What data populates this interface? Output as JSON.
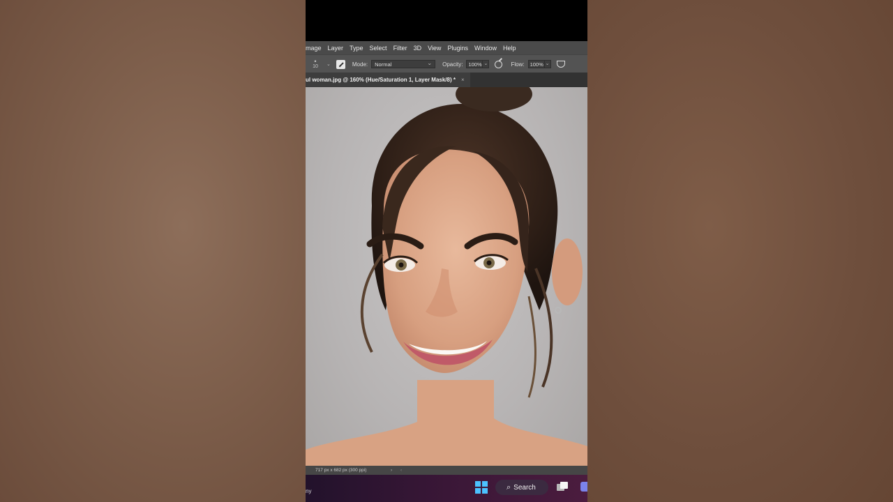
{
  "menubar": {
    "items": [
      "mage",
      "Layer",
      "Type",
      "Select",
      "Filter",
      "3D",
      "View",
      "Plugins",
      "Window",
      "Help"
    ]
  },
  "options": {
    "brush_size": "10",
    "mode_label": "Mode:",
    "mode_value": "Normal",
    "opacity_label": "Opacity:",
    "opacity_value": "100%",
    "flow_label": "Flow:",
    "flow_value": "100%"
  },
  "document": {
    "tab_title": "ul woman.jpg @ 160% (Hue/Saturation 1, Layer Mask/8) *",
    "close_glyph": "×"
  },
  "status": {
    "doc_size": "717 px x 682 px (300 ppi)",
    "arrow": "›",
    "arrow2": "‹"
  },
  "taskbar": {
    "cut_text": "ny",
    "search_label": "Search"
  },
  "colors": {
    "menubar_bg": "#4a4a4a",
    "options_bg": "#535353",
    "windows_accent": "#4cc2ff"
  },
  "icons": [
    "brush-tool-icon",
    "pressure-opacity-icon",
    "airbrush-icon",
    "windows-start-icon",
    "search-icon",
    "task-view-icon",
    "teams-icon"
  ]
}
